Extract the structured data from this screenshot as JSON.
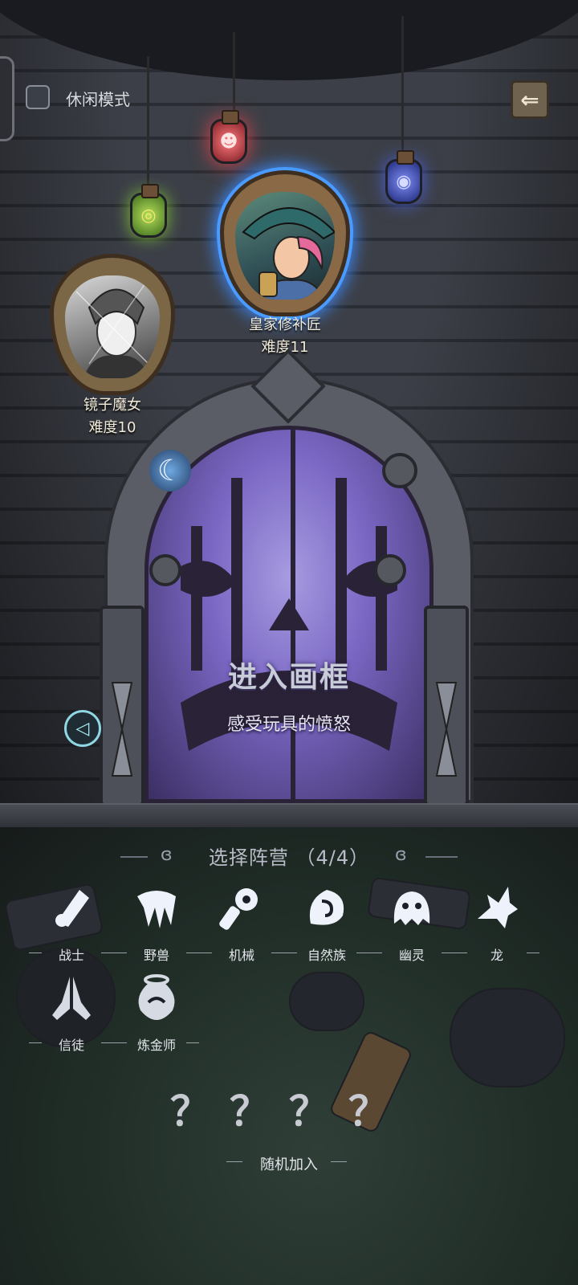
{
  "top": {
    "casual_mode_label": "休闲模式",
    "casual_mode_checked": false
  },
  "portraits": [
    {
      "name": "镜子魔女",
      "difficulty": "难度10",
      "state": "locked"
    },
    {
      "name": "皇家修补匠",
      "difficulty": "难度11",
      "state": "selected"
    }
  ],
  "door": {
    "title": "进入画框",
    "subtitle": "感受玩具的愤怒"
  },
  "faction_section": {
    "title": "选择阵营 （4/4）",
    "factions": [
      {
        "label": "战士",
        "icon": "warrior-icon"
      },
      {
        "label": "野兽",
        "icon": "beast-icon"
      },
      {
        "label": "机械",
        "icon": "mech-icon"
      },
      {
        "label": "自然族",
        "icon": "nature-icon"
      },
      {
        "label": "幽灵",
        "icon": "ghost-icon"
      },
      {
        "label": "龙",
        "icon": "dragon-icon"
      },
      {
        "label": "信徒",
        "icon": "believer-icon"
      },
      {
        "label": "炼金师",
        "icon": "alchemist-icon"
      }
    ]
  },
  "random": {
    "marks": "？？？？",
    "label": "随机加入"
  },
  "colors": {
    "door_glow": "#8f7fd6",
    "portrait_selected_glow": "#3e8cff",
    "lantern_green": "#7fbf3a",
    "lantern_red": "#e0444c",
    "lantern_blue": "#4b62d8"
  }
}
